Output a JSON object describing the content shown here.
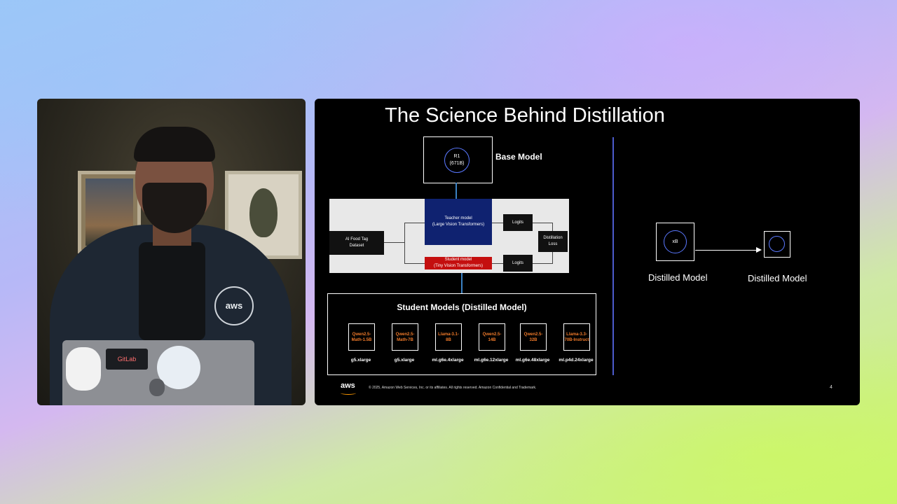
{
  "camera": {
    "chest_logo": "aws",
    "sticker_text": "GitLab"
  },
  "slide": {
    "title": "The Science Behind Distillation",
    "base_model": {
      "circle_line1": "R1",
      "circle_line2": "(671B)",
      "label": "Base Model"
    },
    "diagram": {
      "dataset_line1": "AI Food Tag",
      "dataset_line2": "Dataset",
      "teacher_line1": "Teacher model",
      "teacher_line2": "(Large Vision Transformers)",
      "student_line1": "Student model",
      "student_line2": "(Tiny Vision Transformers)",
      "logits1": "Logits",
      "logits2": "Logits",
      "loss_line1": "Distillation",
      "loss_line2": "Loss"
    },
    "student_models": {
      "title": "Student Models (Distilled Model)",
      "models": [
        {
          "name": "Qwen2.5-Math-1.5B",
          "instance": "g5.xlarge"
        },
        {
          "name": "Qwen2.5-Math-7B",
          "instance": "g5.xlarge"
        },
        {
          "name": "Llama-3.1-8B",
          "instance": "ml.g6e.4xlarge"
        },
        {
          "name": "Qwen2.5-14B",
          "instance": "ml.g6e.12xlarge"
        },
        {
          "name": "Qwen2.5-32B",
          "instance": "ml.g6e.48xlarge"
        },
        {
          "name": "Llama-3.3-70B-Instruct",
          "instance": "ml.p4d.24xlarge"
        }
      ]
    },
    "distilled": {
      "circle_label": "xB",
      "label_left": "Distilled Model",
      "label_right": "Distilled Model"
    },
    "footer": {
      "logo": "aws",
      "copyright": "© 2025, Amazon Web Services, Inc. or its affiliates. All rights reserved. Amazon Confidential and Trademark.",
      "page_number": "4"
    }
  },
  "colors": {
    "teacher": "#0f2270",
    "student": "#c40f0f",
    "model_text": "#f07a2a",
    "divider": "#4c5ccd",
    "aws_smile": "#ff9900"
  }
}
